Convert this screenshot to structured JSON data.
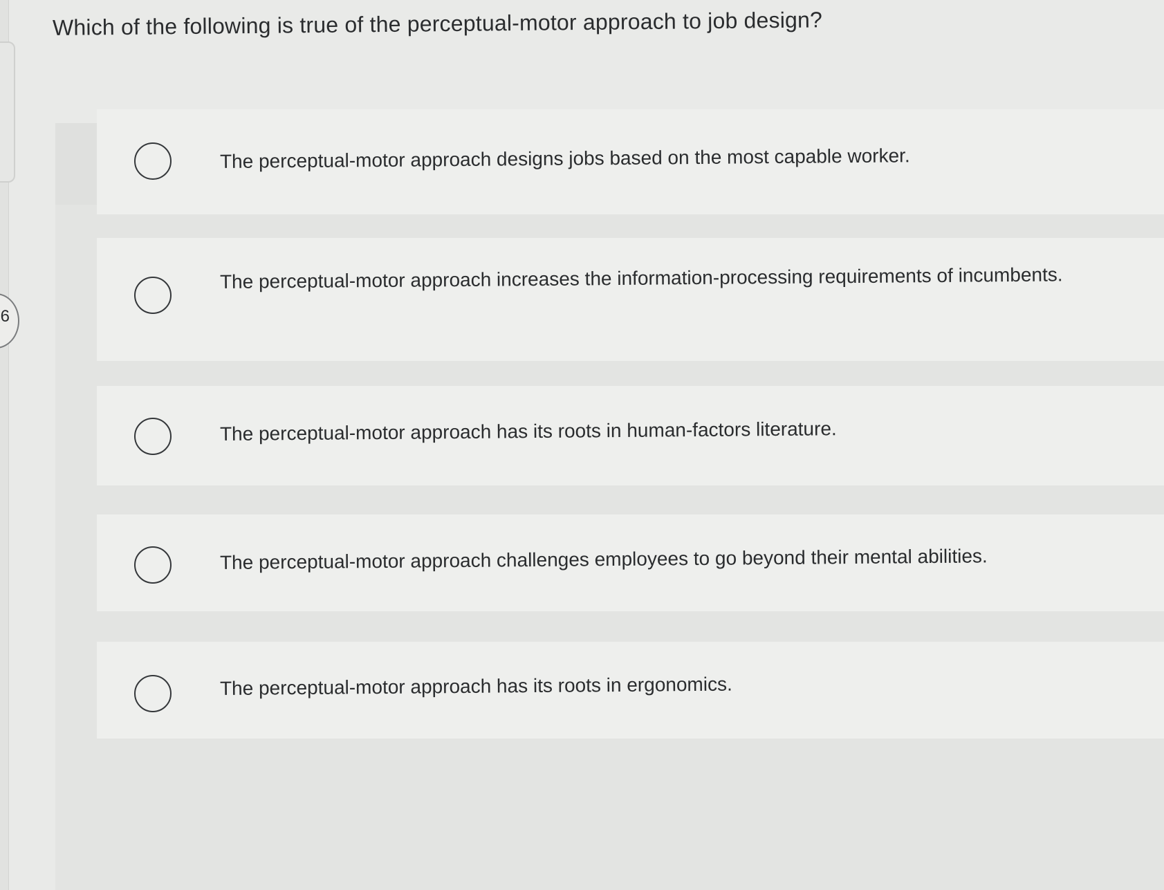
{
  "question": {
    "number": "6",
    "text": "Which of the following is true of the perceptual-motor approach to job design?"
  },
  "question_type": "Multiple Choice",
  "options": [
    {
      "label": "The perceptual-motor approach designs jobs based on the most capable worker.",
      "selected": false
    },
    {
      "label": "The perceptual-motor approach increases the information-processing requirements of incumbents.",
      "selected": false
    },
    {
      "label": "The perceptual-motor approach has its roots in human-factors literature.",
      "selected": false
    },
    {
      "label": "The perceptual-motor approach challenges employees to go beyond their mental abilities.",
      "selected": false
    },
    {
      "label": "The perceptual-motor approach has its roots in ergonomics.",
      "selected": false
    }
  ]
}
